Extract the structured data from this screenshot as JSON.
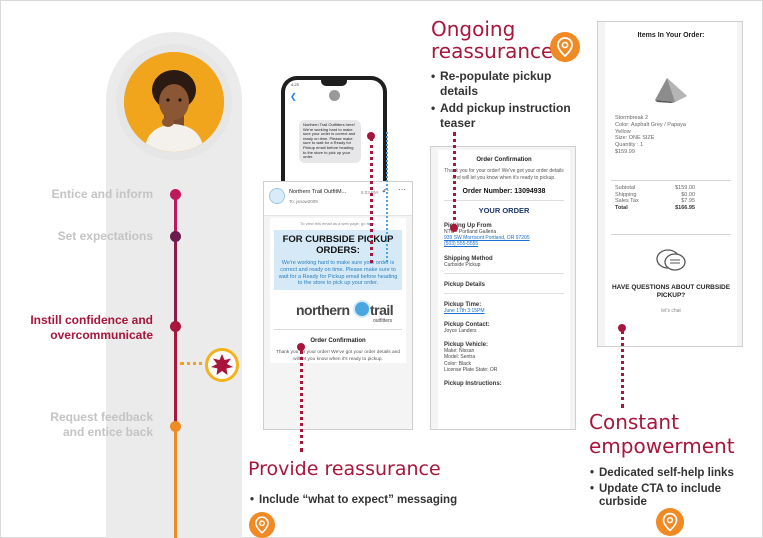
{
  "journey": {
    "stages": [
      {
        "label": "Entice and inform",
        "state": "inactive",
        "color": "#c2185b"
      },
      {
        "label": "Set expectations",
        "state": "inactive",
        "color": "#6d1b4e"
      },
      {
        "label": "Instill confidence and overcommunicate",
        "state": "active",
        "color": "#a8163b"
      },
      {
        "label": "Request feedback and entice back",
        "state": "inactive",
        "color": "#f08a24"
      }
    ],
    "stage_lines": [
      "Instill confidence and",
      "overcommunicate"
    ],
    "stage_lines_feedback": [
      "Request feedback",
      "and entice back"
    ],
    "marker_icon": "starburst-icon",
    "colors": {
      "active": "#a8163b",
      "inactive": "#c4c4c4",
      "accent": "#f08a24"
    }
  },
  "sms": {
    "status_time": "4:23",
    "message": "Northern Trail Outfitters here! We're working hard to make sure your order is correct and ready on time. Please make sure to wait for a Ready for Pickup email before heading to the store to pick up your order."
  },
  "email": {
    "sender": "Northern Trail OutfitM...",
    "time": "6:03 PM",
    "to": "To: jsnow2009",
    "web_link_text": "To view this email as a web page, go",
    "web_link_label": "here.",
    "banner_title": "FOR CURBSIDE PICKUP ORDERS:",
    "banner_text": "We're working hard to make sure your order is correct and ready on time. Please make sure to wait for a Ready for Pickup email before heading to the store to pick up your order.",
    "brand_part1": "northern",
    "brand_part2": "trail",
    "brand_sub": "outfitters",
    "confirmation_title": "Order Confirmation",
    "confirmation_text": "Thank you for your order! We've got your order details and will let you know when it's ready to pickup."
  },
  "order": {
    "title": "Order Confirmation",
    "text": "Thank you for your order! We've got your order details and will let you know when it's ready to pickup.",
    "number_label": "Order Number: 13094938",
    "your_order": "YOUR ORDER",
    "pickup_from_h": "Picking Up From",
    "pickup_store": "NTO - Portland Galleria",
    "pickup_address": "939 SW Morrisont Portland, OR 97205",
    "pickup_phone": "(503) 555-5555",
    "shipping_h": "Shipping Method",
    "shipping_val": "Curbside Pickup",
    "details_h": "Pickup Details",
    "time_h": "Pickup Time:",
    "time_val": "June 17th 3:15PM",
    "contact_h": "Pickup Contact:",
    "contact_val": "Joyce Landers",
    "vehicle_h": "Pickup Vehicle:",
    "vehicle_lines": [
      "Make: Nissan",
      "Model: Sentra",
      "Color: Black",
      "License Plate State: OR"
    ],
    "instructions_h": "Pickup Instructions:"
  },
  "items": {
    "title": "Items In Your Order:",
    "desc_lines": [
      "Stormbreak 2",
      "Color: Asphalt Grey / Papaya",
      "Yellow",
      "Size: ONE SIZE",
      "Quantity : 1",
      "$159.99"
    ],
    "totals": [
      {
        "label": "Subtotal",
        "value": "$159.00"
      },
      {
        "label": "Shipping",
        "value": "$0.00"
      },
      {
        "label": "Sales Tax",
        "value": "$7.95"
      },
      {
        "label": "Total",
        "value": "$166.95"
      }
    ],
    "question": "HAVE QUESTIONS ABOUT CURBSIDE PICKUP?",
    "chat_label": "let's chat"
  },
  "callouts": {
    "ongoing": {
      "heading_line1": "Ongoing",
      "heading_line2": "reassurance",
      "bullets": [
        "Re-populate pickup details",
        "Add pickup instruction teaser"
      ],
      "icon": "location-pin-icon"
    },
    "provide": {
      "heading": "Provide reassurance",
      "bullets": [
        "Include “what to expect” messaging"
      ],
      "icon": "location-pin-icon"
    },
    "constant": {
      "heading_line1": "Constant",
      "heading_line2": "empowerment",
      "bullets": [
        "Dedicated self-help links",
        "Update CTA to include curbside"
      ],
      "icon": "location-pin-icon"
    }
  },
  "colors": {
    "brand_red": "#a8163b",
    "orange": "#f08a24",
    "light_blue": "#d6e9f6",
    "link_blue": "#1a6fd0"
  }
}
